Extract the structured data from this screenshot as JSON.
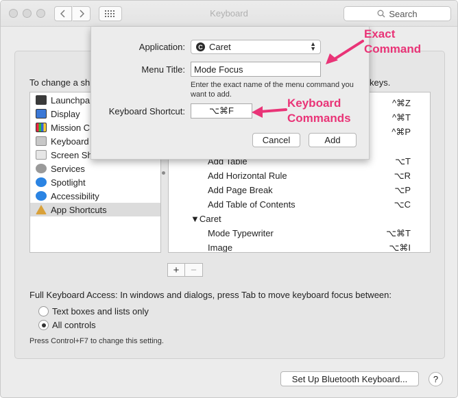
{
  "window": {
    "title": "Keyboard",
    "search_placeholder": "Search"
  },
  "panel": {
    "intro_left": "To change a sh",
    "intro_right": "keys.",
    "categories": [
      {
        "label": "Launchpa",
        "icon": "launchpad-icon",
        "color": "#3a3a3a"
      },
      {
        "label": "Display",
        "icon": "display-icon",
        "color": "#3b78d6"
      },
      {
        "label": "Mission C",
        "icon": "mission-control-icon",
        "color": "#3c3c3c"
      },
      {
        "label": "Keyboard",
        "icon": "keyboard-icon",
        "color": "#9a9a9a"
      },
      {
        "label": "Screen Sh",
        "icon": "screenshot-icon",
        "color": "#b0b0b0"
      },
      {
        "label": "Services",
        "icon": "services-icon",
        "color": "#8a8a8a"
      },
      {
        "label": "Spotlight",
        "icon": "spotlight-icon",
        "color": "#2b84e3"
      },
      {
        "label": "Accessibility",
        "icon": "accessibility-icon",
        "color": "#2b84e3"
      },
      {
        "label": "App Shortcuts",
        "icon": "app-shortcuts-icon",
        "color": "#d9a13a"
      }
    ],
    "shortcuts_top": [
      {
        "key": "^⌘Z"
      },
      {
        "key": "^⌘T"
      },
      {
        "key": "^⌘P"
      }
    ],
    "shortcuts": [
      {
        "name": "Add Table",
        "key": "⌥T"
      },
      {
        "name": "Add Horizontal Rule",
        "key": "⌥R"
      },
      {
        "name": "Add Page Break",
        "key": "⌥P"
      },
      {
        "name": "Add Table of Contents",
        "key": "⌥C"
      }
    ],
    "group": {
      "label": "▼Caret"
    },
    "group_shortcuts": [
      {
        "name": "Mode Typewriter",
        "key": "⌥⌘T"
      },
      {
        "name": "Image",
        "key": "⌥⌘I"
      }
    ],
    "plus_label": "+",
    "minus_label": "−",
    "full_keyboard_access": "Full Keyboard Access: In windows and dialogs, press Tab to move keyboard focus between:",
    "radio_text_boxes": "Text boxes and lists only",
    "radio_all_controls": "All controls",
    "hint": "Press Control+F7 to change this setting.",
    "bluetooth_button": "Set Up Bluetooth Keyboard...",
    "help_button": "?"
  },
  "sheet": {
    "application_label": "Application:",
    "application_value": "Caret",
    "application_logo": "C",
    "menu_title_label": "Menu Title:",
    "menu_title_value": "Mode Focus",
    "help_text": "Enter the exact name of the menu command you want to add.",
    "shortcut_label": "Keyboard Shortcut:",
    "shortcut_value": "⌥⌘F",
    "cancel": "Cancel",
    "add": "Add"
  },
  "annotations": {
    "exact_command_1": "Exact",
    "exact_command_2": "Command",
    "keyboard_commands_1": "Keyboard",
    "keyboard_commands_2": "Commands",
    "color": "#e93477"
  }
}
